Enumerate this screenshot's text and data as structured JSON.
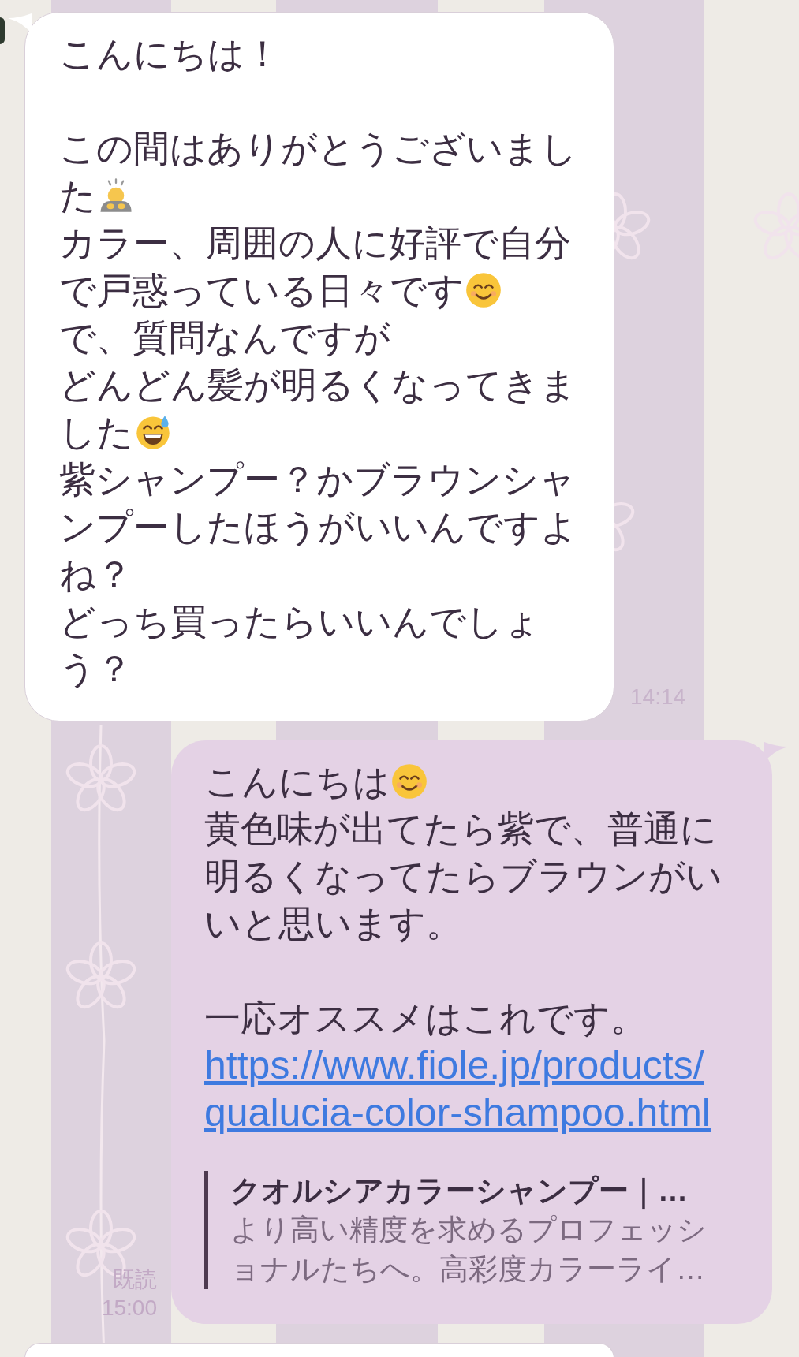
{
  "messages": [
    {
      "kind": "incoming",
      "paragraphs": [
        [
          {
            "text": "こんにちは！"
          }
        ],
        [
          {
            "text": "この間はありがとうございまし"
          },
          {
            "text": "た",
            "kind": "bowing-person"
          },
          {
            "text": "カラー、周囲の人に好評で自分"
          },
          {
            "text": "で戸惑っている日々です",
            "kind": "smiling-face"
          },
          {
            "text": "で、質問なんですが"
          },
          {
            "text": "どんどん髪が明るくなってきま"
          },
          {
            "text": "した",
            "kind": "grinning-sweat"
          },
          {
            "text": "紫シャンプー？かブラウンシャ"
          },
          {
            "text": "ンプーしたほうがいいんですよ"
          },
          {
            "text": "ね？"
          },
          {
            "text": "どっち買ったらいいんでしょ"
          },
          {
            "text": "う？"
          }
        ]
      ],
      "time": "14:14"
    },
    {
      "kind": "outgoing",
      "paragraphs": [
        [
          {
            "text": "こんにちは",
            "kind": "smiling-face"
          },
          {
            "text": "黄色味が出てたら紫で、普通に"
          },
          {
            "text": "明るくなってたらブラウンがい"
          },
          {
            "text": "いと思います。"
          }
        ],
        [
          {
            "text": "一応オススメはこれです。"
          }
        ]
      ],
      "link": {
        "lines": [
          "https://www.fiole.jp/products/",
          "qualucia-color-shampoo.html"
        ]
      },
      "preview": {
        "title": "クオルシアカラーシャンプー｜…",
        "description": [
          "より高い精度を求めるプロフェッシ",
          "ョナルたちへ。高彩度カラーライ…"
        ]
      },
      "read": "既読",
      "time": "15:00"
    },
    {
      "kind": "incoming-partial"
    }
  ]
}
